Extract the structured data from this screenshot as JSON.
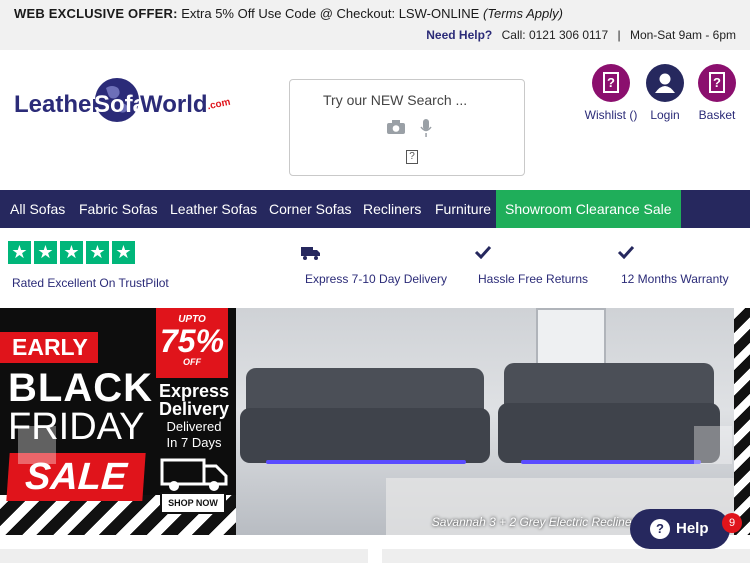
{
  "topbar": {
    "offer_bold": "WEB EXCLUSIVE OFFER:",
    "offer_text": "Extra 5% Off Use Code @ Checkout: LSW-ONLINE",
    "offer_terms": "(Terms Apply)",
    "need_help": "Need Help?",
    "call": "Call: 0121 306 0117",
    "separator": "|",
    "hours": "Mon-Sat 9am - 6pm"
  },
  "header": {
    "logo_text_1": "Leather",
    "logo_text_2": "Sofa",
    "logo_text_3": "World",
    "logo_dotcom": ".com",
    "search_placeholder": "Try our NEW Search ...",
    "search_qbox": "?",
    "wishlist_label": "Wishlist ()",
    "login_label": "Login",
    "basket_label": "Basket",
    "icon_glyph": "?",
    "accent_purple": "#8b0f6e",
    "accent_navy": "#26285e"
  },
  "nav": {
    "items": [
      "All Sofas",
      "Fabric Sofas",
      "Leather Sofas",
      "Corner Sofas",
      "Recliners",
      "Furniture"
    ],
    "sale_item": "Showroom Clearance Sale",
    "sale_color": "#1fae5a"
  },
  "usp": {
    "star_glyph": "★",
    "rated_text": "Rated Excellent On TrustPilot",
    "delivery": "Express 7-10 Day Delivery",
    "returns": "Hassle Free Returns",
    "warranty": "12 Months Warranty",
    "star_color": "#00b67a"
  },
  "banner": {
    "early": "EARLY",
    "black": "BLACK",
    "friday": "FRIDAY",
    "sale": "SALE",
    "upto": "UPTO",
    "percent": "75%",
    "off": "OFF",
    "express_1": "Express",
    "express_2": "Delivery",
    "delivered_1": "Delivered",
    "delivered_2": "In 7 Days",
    "shop_now": "SHOP NOW",
    "caption": "Savannah 3 + 2 Grey Electric Recliners Was £1699 Save"
  },
  "help_widget": {
    "label": "Help",
    "glyph": "?",
    "badge": "9"
  }
}
